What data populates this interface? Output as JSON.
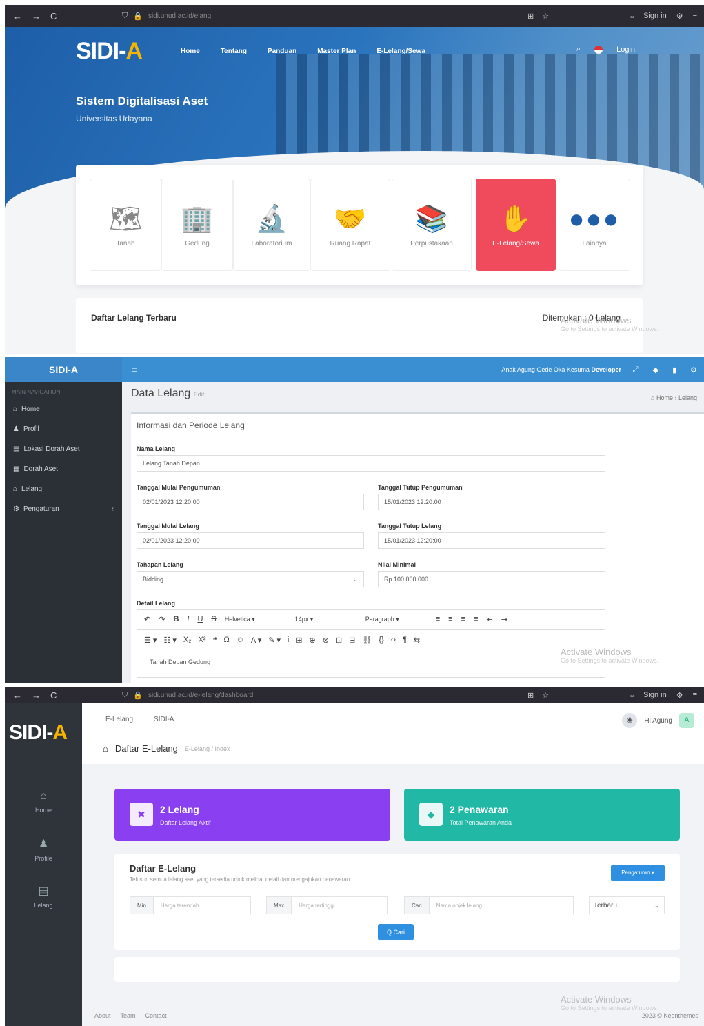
{
  "panel1": {
    "browser": {
      "nav": [
        "←",
        "→",
        "C"
      ],
      "url": "sidi.unud.ac.id/elang",
      "controls": [
        "⊞",
        "☆"
      ],
      "right": [
        "⤓",
        "Sign in",
        "⚙",
        "≡"
      ]
    },
    "logo_main": "SIDI-",
    "logo_accent": "A",
    "nav": [
      "Home",
      "Tentang",
      "Panduan",
      "Master Plan",
      "E-Lelang/Sewa"
    ],
    "login": "Login",
    "title": "Sistem Digitalisasi Aset",
    "subtitle": "Universitas Udayana",
    "categories": [
      {
        "label": "Tanah",
        "icon": "🗺"
      },
      {
        "label": "Gedung",
        "icon": "🏢"
      },
      {
        "label": "Laboratorium",
        "icon": "🔬"
      },
      {
        "label": "Ruang Rapat",
        "icon": "🤝"
      },
      {
        "label": "Perpustakaan",
        "icon": "📚"
      },
      {
        "label": "E-Lelang/Sewa",
        "icon": "✋"
      },
      {
        "label": "Lainnya",
        "icon": "●●●"
      }
    ],
    "list_title": "Daftar Lelang Terbaru",
    "found": "Ditemukan : 0 Lelang",
    "watermark": "Activate Windows",
    "watermark_sub": "Go to Settings to activate Windows."
  },
  "panel2": {
    "brand": "SIDI-A",
    "menu_header": "MAIN NAVIGATION",
    "menu": [
      {
        "icon": "⌂",
        "label": "Home"
      },
      {
        "icon": "♟",
        "label": "Profil"
      },
      {
        "icon": "▤",
        "label": "Lokasi Dorah Aset"
      },
      {
        "icon": "▦",
        "label": "Dorah Aset"
      },
      {
        "icon": "⌂",
        "label": "Lelang"
      },
      {
        "icon": "⚙",
        "label": "Pengaturan"
      }
    ],
    "user": "Anak Agung Gede Oka Kesuma",
    "user_role": "Developer",
    "page_title": "Data Lelang",
    "page_sub": "Edit",
    "breadcrumb": "⌂ Home  ›  Lelang",
    "section_title": "Informasi dan Periode Lelang",
    "fields": {
      "nama_label": "Nama Lelang",
      "nama_value": "Lelang Tanah Depan",
      "mulai_umum_label": "Tanggal Mulai Pengumuman",
      "mulai_umum_value": "02/01/2023 12:20:00",
      "tutup_umum_label": "Tanggal Tutup Pengumuman",
      "tutup_umum_value": "15/01/2023 12:20:00",
      "mulai_lelang_label": "Tanggal Mulai Lelang",
      "mulai_lelang_value": "02/01/2023 12:20:00",
      "tutup_lelang_label": "Tanggal Tutup Lelang",
      "tutup_lelang_value": "15/01/2023 12:20:00",
      "tahapan_label": "Tahapan Lelang",
      "tahapan_value": "Bidding",
      "nilai_label": "Nilai Minimal",
      "nilai_value": "Rp 100.000.000",
      "detail_label": "Detail Lelang",
      "detail_value": "Tanah Depan Gedung"
    },
    "toolbar1": [
      "↶",
      "↷",
      "B",
      "I",
      "U",
      "S",
      "Helvetica ▾",
      "14px ▾",
      "Paragraph ▾",
      "≡",
      "≡",
      "≡",
      "≡",
      "⇤",
      "⇥"
    ],
    "toolbar2": [
      "☰ ▾",
      "☷ ▾",
      "X₂",
      "X²",
      "❝",
      "Ω",
      "☺",
      "A ▾",
      "✎ ▾",
      "Ꭵ",
      "⊞",
      "⊕",
      "⊗",
      "⊡",
      "⊟",
      "⛓",
      "{}",
      "‹›",
      "¶",
      "⇆"
    ],
    "watermark": "Activate Windows",
    "watermark_sub": "Go to Settings to activate Windows."
  },
  "panel3": {
    "browser": {
      "nav": [
        "←",
        "→",
        "C"
      ],
      "url": "sidi.unud.ac.id/e-lelang/dashboard",
      "controls": [
        "⊞",
        "☆"
      ],
      "right": [
        "⤓",
        "Sign in",
        "⚙",
        "≡"
      ]
    },
    "logo_main": "SIDI-",
    "logo_accent": "A",
    "menu": [
      {
        "icon": "⌂",
        "label": "Home"
      },
      {
        "icon": "♟",
        "label": "Profile"
      },
      {
        "icon": "▤",
        "label": "Lelang"
      }
    ],
    "top_links": [
      "E-Lelang",
      "SIDI-A"
    ],
    "page_title": "Daftar E-Lelang",
    "page_crumb": "E-Lelang / Index",
    "user": "Hi Agung",
    "user_initial": "A",
    "stats": [
      {
        "num": "2 Lelang",
        "sub": "Daftar Lelang Aktif",
        "color": "#8a3ff0",
        "icon": "✖"
      },
      {
        "num": "2 Penawaran",
        "sub": "Total Penawaran Anda",
        "color": "#21b8a6",
        "icon": "◆"
      }
    ],
    "list_title": "Daftar E-Lelang",
    "list_desc": "Telusuri semua lelang aset yang tersedia untuk melihat detail dan mengajukan penawaran.",
    "btn_filter": "Pengaturan ▾",
    "filters": [
      {
        "prefix": "Min",
        "placeholder": "Harga terendah"
      },
      {
        "prefix": "Max",
        "placeholder": "Harga tertinggi"
      },
      {
        "prefix": "Cari",
        "placeholder": "Nama objek lelang"
      }
    ],
    "sort": "Terbaru",
    "search_btn": "Q Cari",
    "footer_links": [
      "About",
      "Team",
      "Contact"
    ],
    "footer_right": "2023 © Keenthemes",
    "watermark": "Activate Windows",
    "watermark_sub": "Go to Settings to activate Windows."
  }
}
